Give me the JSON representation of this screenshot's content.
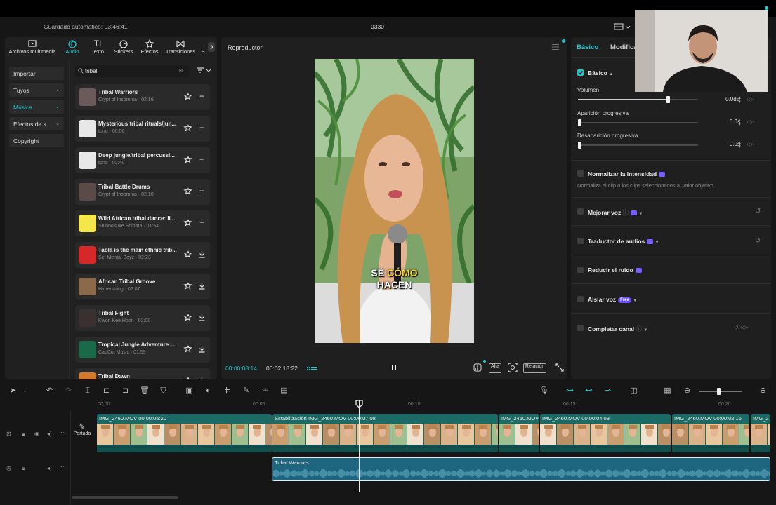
{
  "header": {
    "autosave": "Guardado automático: 03:46:41",
    "project_title": "0330"
  },
  "media_tabs": [
    {
      "label": "Archivos multimedia",
      "icon": "media-icon",
      "active": false
    },
    {
      "label": "Audio",
      "icon": "audio-icon",
      "active": true
    },
    {
      "label": "Texto",
      "icon": "text-icon",
      "active": false
    },
    {
      "label": "Stickers",
      "icon": "sticker-icon",
      "active": false
    },
    {
      "label": "Efectos",
      "icon": "effects-icon",
      "active": false
    },
    {
      "label": "Transiciones",
      "icon": "transitions-icon",
      "active": false
    },
    {
      "label": "S",
      "icon": "more-icon",
      "active": false
    }
  ],
  "categories": [
    {
      "label": "Importar",
      "chevron": false,
      "active": false
    },
    {
      "label": "Tuyos",
      "chevron": true,
      "active": false
    },
    {
      "label": "Música",
      "chevron": true,
      "active": true
    },
    {
      "label": "Efectos de s...",
      "chevron": true,
      "active": false
    },
    {
      "label": "Copyright",
      "chevron": false,
      "active": false
    }
  ],
  "search": {
    "value": "tribal",
    "placeholder": ""
  },
  "tracks": [
    {
      "name": "Tribal Warriors",
      "meta": "Crypt of Insomnia · 02:16",
      "action": "add",
      "thumb": "#6a5a5a"
    },
    {
      "name": "Mysterious tribal rituals/jun...",
      "meta": "tono · 00:56",
      "action": "add",
      "thumb": "#e8e8e8"
    },
    {
      "name": "Deep jungle/tribal percussi...",
      "meta": "tono · 02:40",
      "action": "add",
      "thumb": "#e8e8e8"
    },
    {
      "name": "Tribal Battle Drums",
      "meta": "Crypt of Insomnia · 02:10",
      "action": "add",
      "thumb": "#5a4a48"
    },
    {
      "name": "Wild African tribal dance: li...",
      "meta": "Shinnosuke Shibata · 01:54",
      "action": "add",
      "thumb": "#f5e64a"
    },
    {
      "name": "Tabla is the main ethnic trib...",
      "meta": "Set Mental Boyz · 02:23",
      "action": "download",
      "thumb": "#d62828"
    },
    {
      "name": "African Tribal Groove",
      "meta": "Hyperstring · 02:07",
      "action": "download",
      "thumb": "#8a6a4a"
    },
    {
      "name": "Tribal Fight",
      "meta": "Kwon Kee Hoon · 02:00",
      "action": "download",
      "thumb": "#3a3030"
    },
    {
      "name": "Tropical Jungle Adventure i...",
      "meta": "CapCut Music · 01:59",
      "action": "download",
      "thumb": "#1a6a4a"
    },
    {
      "name": "Tribal Dawn",
      "meta": "",
      "action": "download",
      "thumb": "#d4782a"
    }
  ],
  "player": {
    "title": "Reproductor",
    "caption_line1_a": "SÉ ",
    "caption_line1_b": "CÓMO",
    "caption_line2": "HACEN",
    "current_time": "00:00:08:14",
    "duration": "00:02:18:22",
    "btn_quality": "Alta",
    "btn_ratio": "Relación"
  },
  "right_panel": {
    "tab_basic": "Básico",
    "tab_modify": "Modifica",
    "section_basic": "Básico",
    "volume_label": "Volumen",
    "volume_value": "0.0dB",
    "volume_level": 0.75,
    "fade_in_label": "Aparición progresiva",
    "fade_in_value": "0.0s",
    "fade_out_label": "Desaparición progresiva",
    "fade_out_value": "0.0s",
    "normalize_label": "Normalizar la intensidad",
    "normalize_desc": "Normaliza el clip o los clips seleccionados al valor objetivo.",
    "enhance_label": "Mejorar voz",
    "translate_label": "Traductor de audios",
    "noise_label": "Reducir el ruido",
    "isolate_label": "Aislar voz",
    "isolate_badge": "Free",
    "channel_label": "Completar canal"
  },
  "ruler_ticks": [
    "00:00",
    "00:05",
    "00:10",
    "00:15",
    "00:20"
  ],
  "timeline": {
    "cover_label": "Portada",
    "video_clips": [
      {
        "label": "IMG_2460.MOV   00:00:05:20"
      },
      {
        "label": "Estabilización   IMG_2460.MOV   00:00:07:08"
      },
      {
        "label": "IMG_2460.MOV"
      },
      {
        "label": "IMG_2460.MOV   00:00:04:08"
      },
      {
        "label": "IMG_2460.MOV   00:00:02:16"
      },
      {
        "label": "IMG_2"
      }
    ],
    "audio_clip": "Tribal Warriors"
  },
  "colors": {
    "accent": "#1fc8cf",
    "panel": "#202020",
    "clip_video": "#1a6b66",
    "clip_audio": "#1e6680"
  }
}
